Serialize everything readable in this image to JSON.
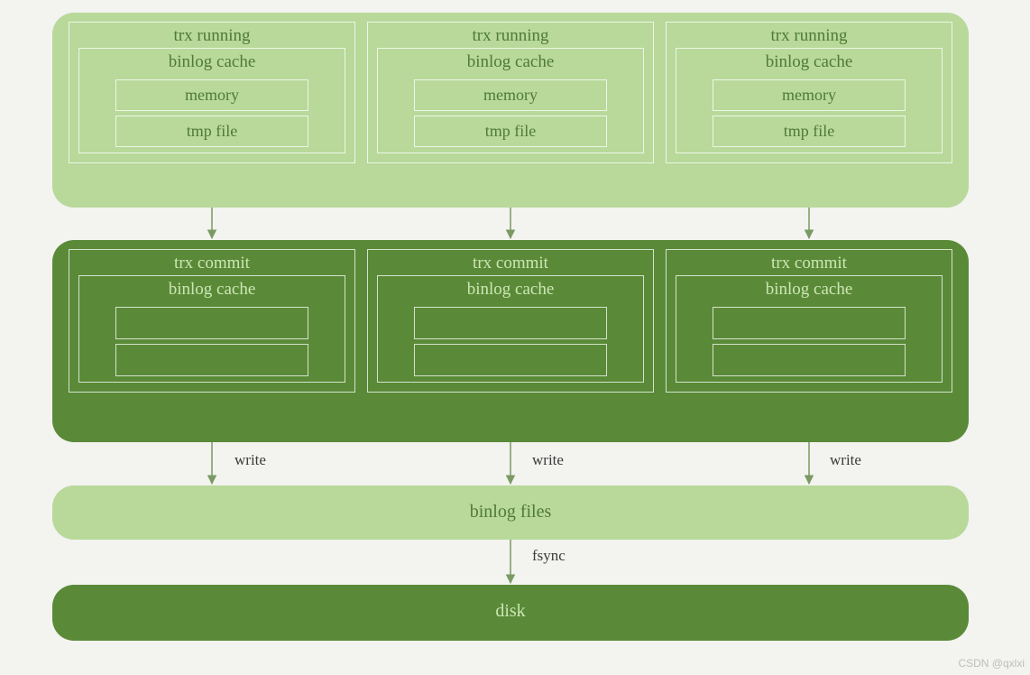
{
  "running_band": {
    "title": "trx running",
    "cache_title": "binlog cache",
    "memory": "memory",
    "tmpfile": "tmp file"
  },
  "commit_band": {
    "title": "trx commit",
    "cache_title": "binlog cache"
  },
  "write_label": "write",
  "binlog_files": "binlog files",
  "fsync_label": "fsync",
  "disk": "disk",
  "watermark": "CSDN @qxlxi"
}
